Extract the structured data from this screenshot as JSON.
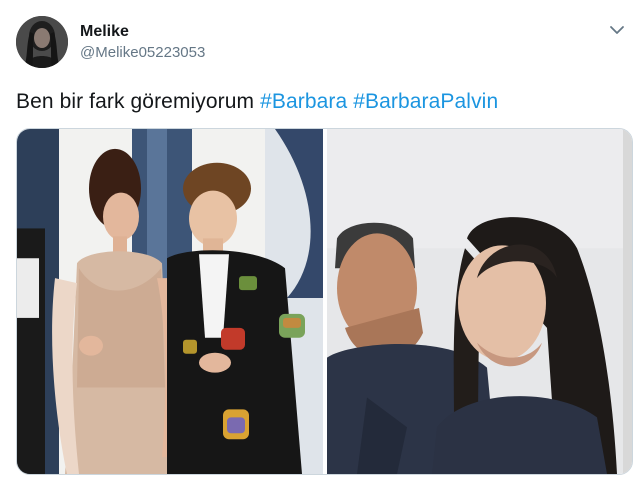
{
  "tweet": {
    "author_name": "Melike",
    "author_handle": "@Melike05223053",
    "text_plain": "Ben bir fark göremiyorum ",
    "hashtags": [
      "#Barbara",
      "#BarbaraPalvin"
    ]
  },
  "icons": {
    "avatar": "user-avatar",
    "menu": "chevron-down-icon"
  },
  "colors": {
    "text": "#14171a",
    "secondary_text": "#657786",
    "hashtag": "#1b95e0",
    "border": "#ccd6dd"
  }
}
